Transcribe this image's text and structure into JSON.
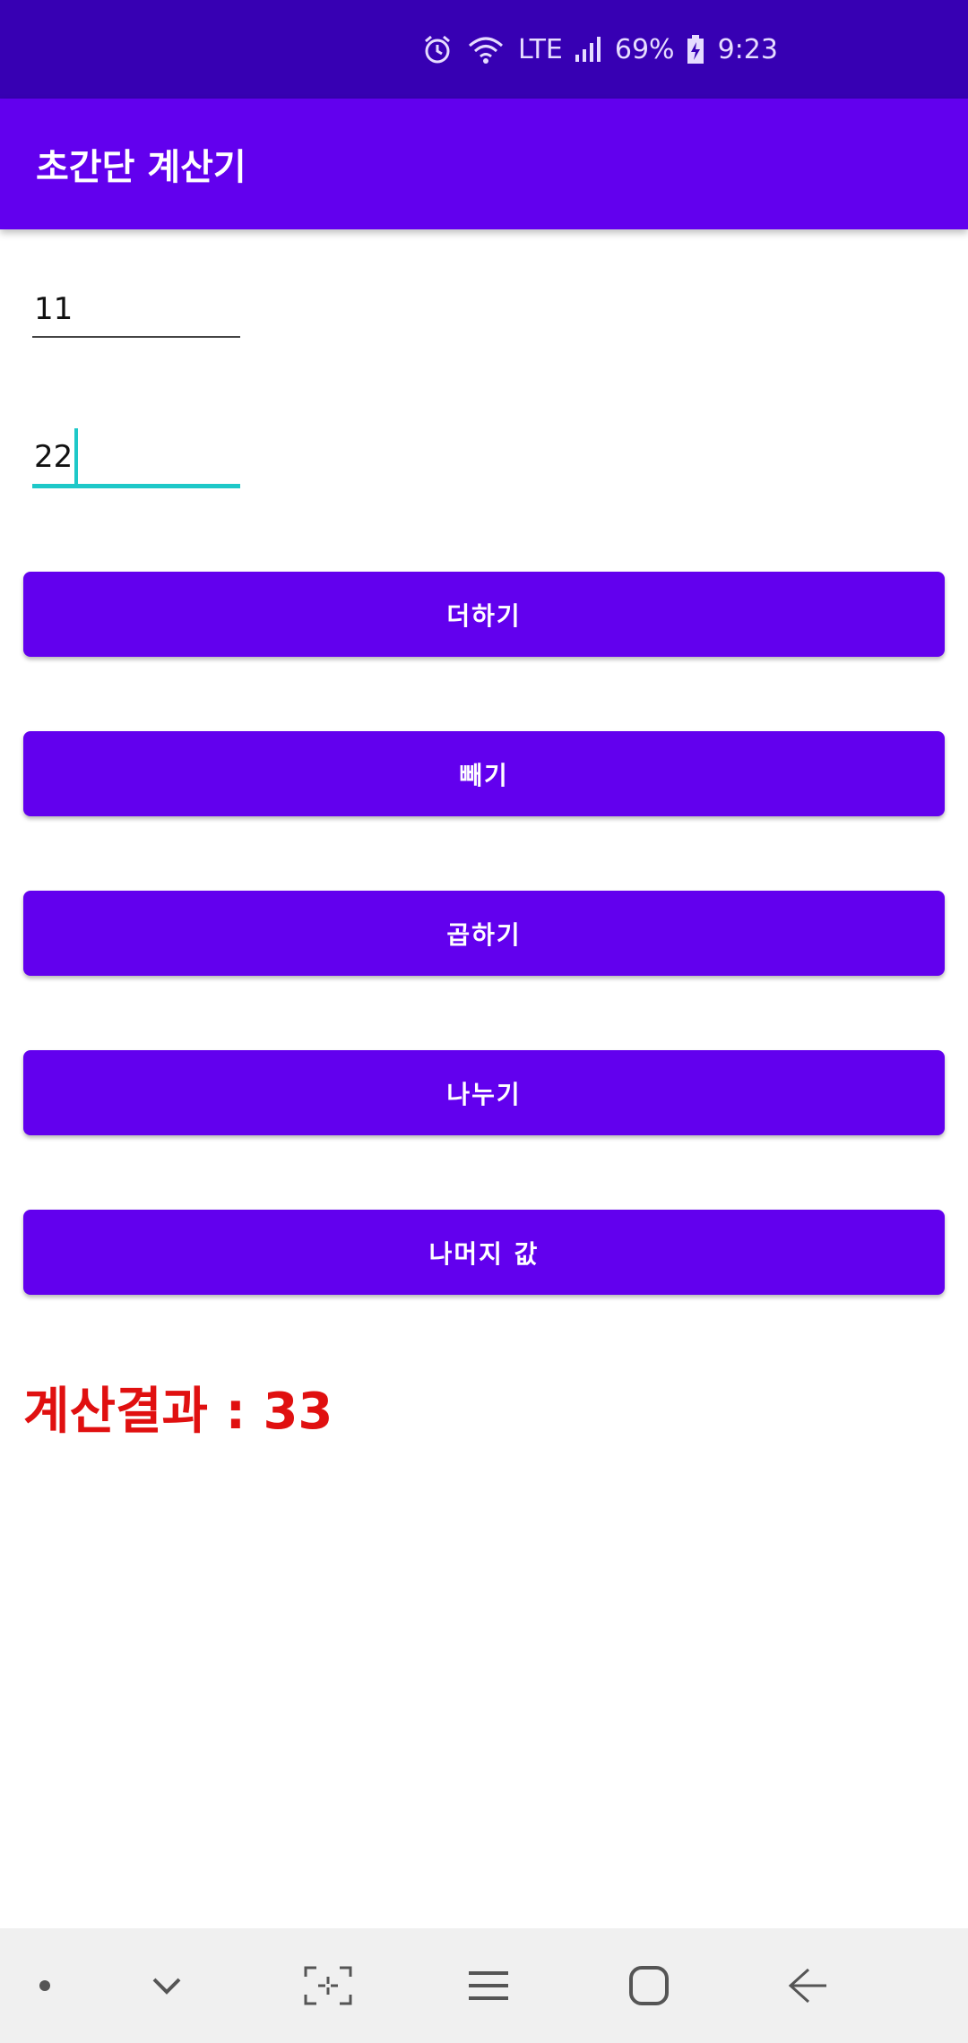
{
  "status_bar": {
    "battery": "69%",
    "time": "9:23",
    "network": "LTE",
    "icons": [
      "alarm-icon",
      "wifi-icon",
      "signal-icon",
      "battery-icon"
    ]
  },
  "app_bar": {
    "title": "초간단 계산기"
  },
  "inputs": {
    "first_value": "11",
    "second_value": "22"
  },
  "buttons": {
    "add": "더하기",
    "subtract": "빼기",
    "multiply": "곱하기",
    "divide": "나누기",
    "remainder": "나머지 값"
  },
  "result": {
    "text": "계산결과 : 33"
  },
  "nav_bar": {
    "icons": [
      "dot-icon",
      "chevron-down-icon",
      "screen-capture-icon",
      "recents-icon",
      "home-icon",
      "back-icon"
    ]
  },
  "colors": {
    "status_bar": "#3700b3",
    "primary": "#6200ee",
    "accent": "#1ec8c8",
    "result_text": "#e01010",
    "nav_bar": "#f0f0f0"
  }
}
